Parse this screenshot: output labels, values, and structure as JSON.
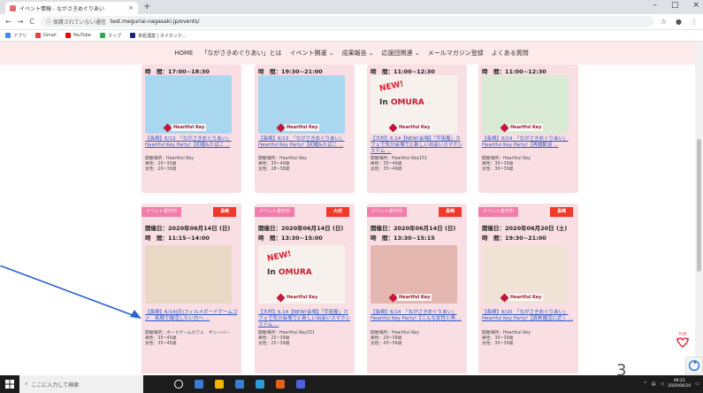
{
  "browser": {
    "tab_title": "イベント情報 - ながさきめぐりあい",
    "tab_close": "×",
    "new_tab": "+",
    "window_controls": [
      "–",
      "□",
      "×"
    ],
    "nav": {
      "back": "←",
      "forward": "→",
      "reload": "C"
    },
    "security": "ⓘ 保護されていない通信",
    "url": "test.meguriai-nagasaki.jp/events/",
    "star": "☆",
    "profile": "●",
    "menu": "⋮"
  },
  "bookmarks": [
    {
      "label": "アプリ",
      "color": "#4285f4"
    },
    {
      "label": "Gmail",
      "color": "#ea4335"
    },
    {
      "label": "YouTube",
      "color": "#ff0000"
    },
    {
      "label": "マップ",
      "color": "#34a853"
    },
    {
      "label": "未処理案 | タイタック...",
      "color": "#1a237e"
    }
  ],
  "site_nav": [
    "HOME",
    "「ながさきめぐりあい」とは",
    "イベント開運 ⌄",
    "成果報告 ⌄",
    "応援団関連 ⌄",
    "メールマガジン登録",
    "よくある質問"
  ],
  "cards_row1": [
    {
      "time": "時　間：17:00~18:30",
      "title": "【長崎】6/13　「ながさきめぐりあい」Heartful Key Party!【初婚&たばこ ...",
      "info": [
        "開催場所：Hearthul Key",
        "男性：20~30歳",
        "女性：20~30歳"
      ],
      "thumb_color": "#a9d7ef",
      "brand": "Heartful Key"
    },
    {
      "time": "時　間：19:30~21:00",
      "title": "【長崎】6/13　「ながさきめぐりあい」Heartful Key Party!【初婚&たばこ ...",
      "info": [
        "開催場所：Hearthul Key",
        "男性：30~40歳",
        "女性：28~38歳"
      ],
      "thumb_color": "#a9d7ef",
      "brand": "Heartful Key"
    },
    {
      "time": "時　間：11:00~12:30",
      "title": "【大村】6.14【NEW!会場】「宇宙屋」カフェで気分会場で2.新しい出会いスマホシステム ...",
      "info": [
        "開催場所：Hearthul Key151",
        "男性：35~49歳",
        "女性：35~49歳"
      ],
      "thumb_color": "#f6f1ec",
      "brand": "Heartful Key",
      "new_text": "NEW!",
      "in_text": "In",
      "in_place": "OMURA"
    },
    {
      "time": "時　間：11:00~12:30",
      "title": "【長崎】6/14　「ながさきめぐりあい」Heartful Key Party!【再婚歓迎 ...",
      "info": [
        "開催場所：Hearthul Key",
        "男性：30~39歳",
        "女性：30~39歳"
      ],
      "thumb_color": "#d9ead5",
      "brand": "Heartful Key"
    }
  ],
  "cards_row2": [
    {
      "tag": "イベント受付中",
      "area": "長崎",
      "date": "開催日：2020年06月14日 (日)",
      "time": "時　間：11:15~14:00",
      "title": "【長崎】6/14(日)フィルメボードゲームコン　笑顔で婚活したい方へ ...",
      "info": [
        "開催場所：ボードゲームカフェ　サニーバー",
        "男性：35~45歳",
        "女性：35~45歳"
      ],
      "thumb_color": "#e9d9c4"
    },
    {
      "tag": "イベント受付中",
      "area": "大村",
      "date": "開催日：2020年06月14日 (日)",
      "time": "時　間：13:30~15:00",
      "title": "【大村】6.14【NEW!会場】「宇宙屋」カフェで気分会場で2.新しい出会いスマホシステム ...",
      "info": [
        "開催場所：Hearthul Key151",
        "男性：25~39歳",
        "女性：25~39歳"
      ],
      "thumb_color": "#f6f1ec",
      "brand": "Heartful Key",
      "new_text": "NEW!",
      "in_text": "In",
      "in_place": "OMURA"
    },
    {
      "tag": "イベント受付中",
      "area": "長崎",
      "date": "開催日：2020年06月14日 (日)",
      "time": "時　間：13:30~15:15",
      "title": "【長崎】6/14　「ながさきめぐりあい」Heartful Key Party!【こんな女性と再 ...",
      "info": [
        "開催場所：Hearthul Key",
        "男性：29~38歳",
        "女性：43~56歳"
      ],
      "thumb_color": "#e4b6b0",
      "brand": "Heartful Key"
    },
    {
      "tag": "イベント受付中",
      "area": "長崎",
      "date": "開催日：2020年06月20日 (土)",
      "time": "時　間：19:30~21:00",
      "title": "【長崎】6/20　「ながさきめぐりあい」Heartful Key Party!【真剣婚活に近く ...",
      "info": [
        "開催場所：Hearthul Key",
        "男性：30~39歳",
        "女性：30~39歳"
      ],
      "thumb_color": "#f1e2d6",
      "brand": "Heartful Key"
    }
  ],
  "page_number": "3",
  "top_badge": "TOP",
  "taskbar": {
    "search_placeholder": "ここに入力して検索",
    "time": "09:21",
    "date": "2020/06/10",
    "icons": [
      "#ffffff",
      "#3a7bd5",
      "#f5b400",
      "#3a7bd5",
      "#2e9cd6",
      "#e25f1c",
      "#4d61d8"
    ]
  },
  "colors": {
    "nav_bg": "#fdeaea",
    "card_bg": "#f9dfe4",
    "tag_pink": "#f27cab",
    "area_red": "#f0392a",
    "link_blue": "#2a56c6",
    "arrow": "#2f63c9"
  }
}
